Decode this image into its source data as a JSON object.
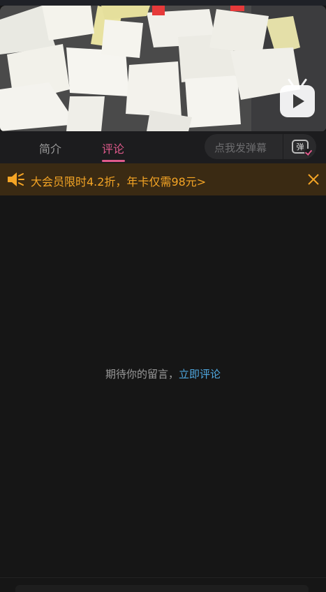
{
  "video": {
    "play_icon": "bilibili-tv-play-icon"
  },
  "tabs": [
    {
      "label": "简介",
      "active": false
    },
    {
      "label": "评论",
      "active": true
    }
  ],
  "danmaku": {
    "placeholder": "点我发弹幕",
    "icon_glyph": "弹",
    "icon": "danmaku-toggle-icon"
  },
  "banner": {
    "text": "大会员限时4.2折，年卡仅需98元>",
    "icon": "speaker-icon",
    "close_icon": "close-icon"
  },
  "empty_state": {
    "text": "期待你的留言，",
    "link": "立即评论"
  },
  "colors": {
    "accent": "#e05a8c",
    "banner_text": "#f5a525",
    "link": "#4fa8e0",
    "background": "#161616"
  }
}
